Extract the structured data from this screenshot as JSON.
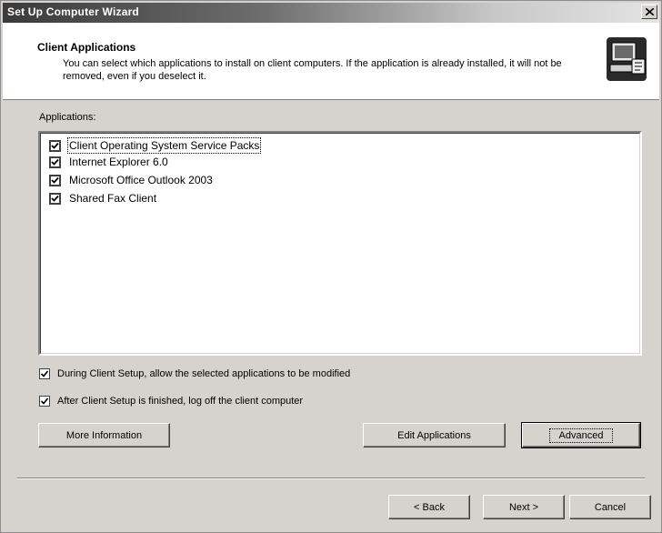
{
  "window": {
    "title": "Set Up Computer Wizard",
    "close_glyph": "×"
  },
  "header": {
    "title": "Client Applications",
    "description": "You can select which applications to install on client computers.  If the application is already installed, it will not be removed, even if you deselect it.",
    "icon": "computer-setup-icon"
  },
  "applications": {
    "label": "Applications:",
    "items": [
      {
        "label": "Client Operating System Service Packs",
        "checked": true
      },
      {
        "label": "Internet Explorer 6.0",
        "checked": true
      },
      {
        "label": "Microsoft Office Outlook 2003",
        "checked": true
      },
      {
        "label": "Shared Fax Client",
        "checked": true
      }
    ]
  },
  "options": {
    "allow_modify": {
      "label": "During Client Setup, allow the selected applications to be modified",
      "checked": true
    },
    "log_off": {
      "label": "After Client Setup is finished, log off the client computer",
      "checked": true
    }
  },
  "buttons": {
    "more_info": "More Information",
    "edit_apps": "Edit Applications",
    "advanced": "Advanced",
    "back": "< Back",
    "next": "Next >",
    "cancel": "Cancel"
  }
}
